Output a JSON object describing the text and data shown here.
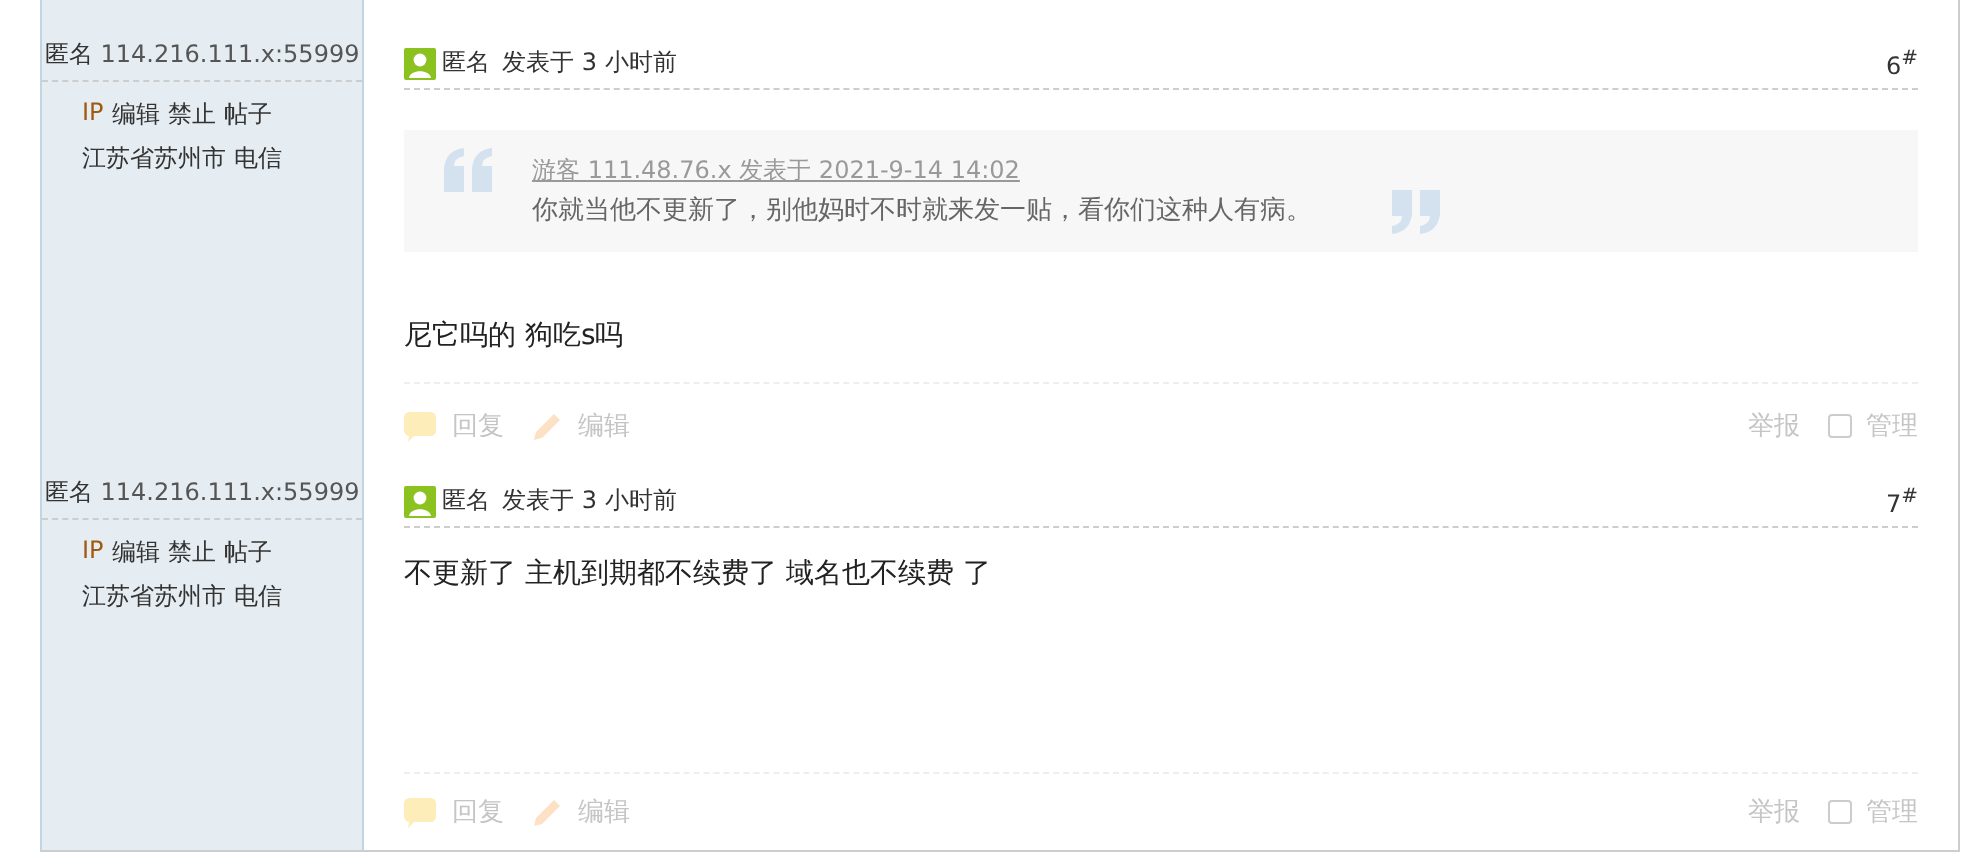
{
  "posts": [
    {
      "author": "匿名",
      "ip": "114.216.111.x:55999",
      "admin_links": [
        "IP",
        "编辑",
        "禁止",
        "帖子"
      ],
      "location": "江苏省苏州市 电信",
      "poster": "匿名",
      "time": "发表于 3 小时前",
      "floor": "6$^{#}$",
      "quote": {
        "meta": "游客 111.48.76.x 发表于 2021-9-14 14:02",
        "text": "你就当他不更新了，别他妈时不时就来发一贴，看你们这种人有病。"
      },
      "message": "尼它吗的 狗吃s吗",
      "actions_left": [
        "回复",
        "编辑"
      ],
      "report": "举报",
      "manage": {
        "label": "管理",
        "checked": false
      }
    },
    {
      "author": "匿名",
      "ip": "114.216.111.x:55999",
      "admin_links": [
        "IP",
        "编辑",
        "禁止",
        "帖子"
      ],
      "location": "江苏省苏州市 电信",
      "poster": "匿名",
      "time": "发表于 3 小时前",
      "floor": "7$^{#}$",
      "message": "不更新了 主机到期都不续费了 域名也不续费 了",
      "actions_left": [
        "回复",
        "编辑"
      ],
      "report": "举报",
      "manage": {
        "label": "管理",
        "checked": false
      }
    }
  ]
}
